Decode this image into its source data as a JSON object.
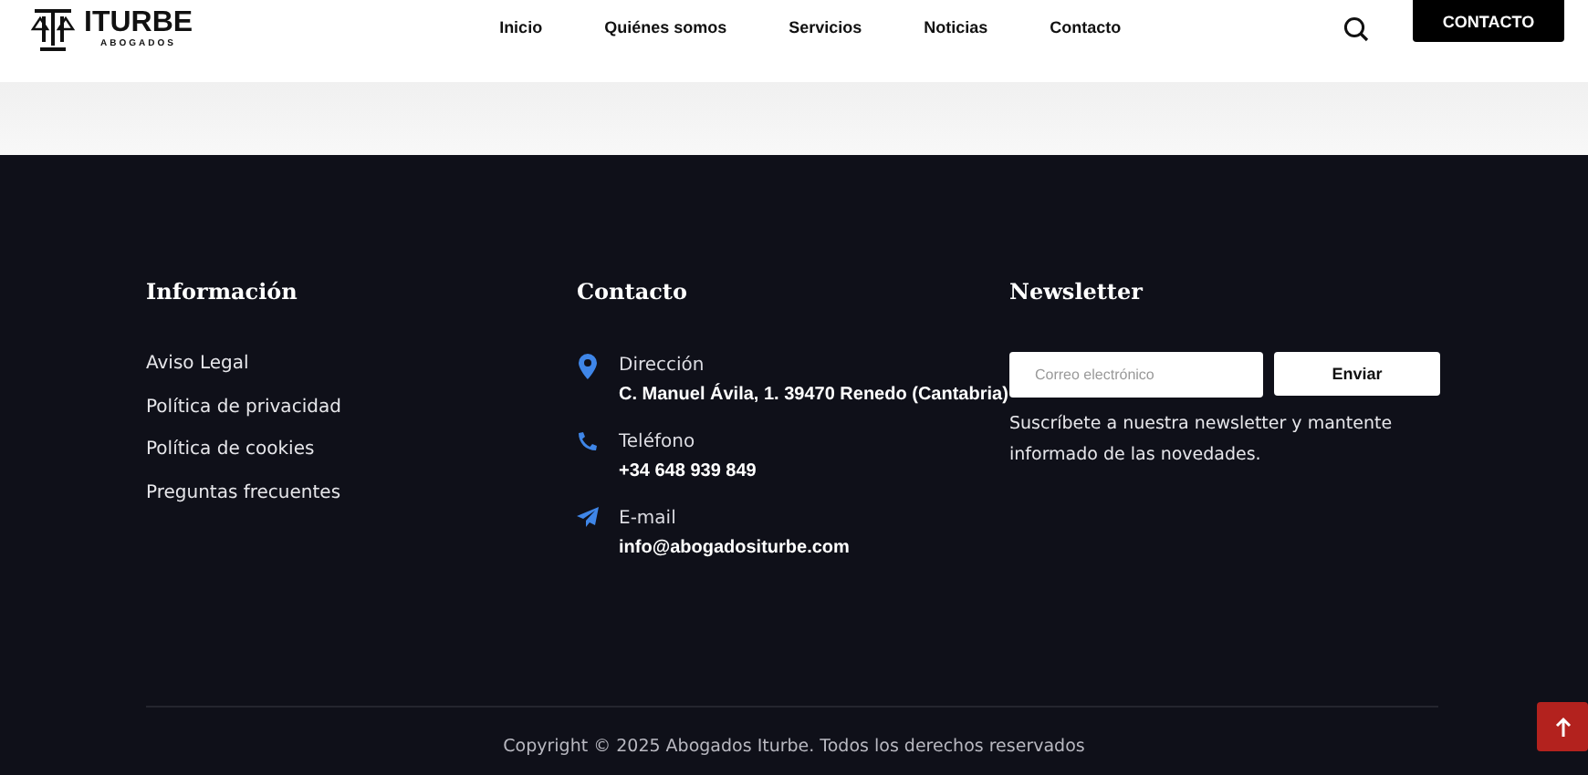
{
  "header": {
    "logo": {
      "name": "ITURBE",
      "tagline": "ABOGADOS"
    },
    "nav": [
      {
        "label": "Inicio"
      },
      {
        "label": "Quiénes somos"
      },
      {
        "label": "Servicios"
      },
      {
        "label": "Noticias"
      },
      {
        "label": "Contacto"
      }
    ],
    "cta": "CONTACTO"
  },
  "footer": {
    "info": {
      "title": "Información",
      "links": [
        "Aviso Legal",
        "Política de privacidad",
        "Política de cookies",
        "Preguntas frecuentes"
      ]
    },
    "contact": {
      "title": "Contacto",
      "items": [
        {
          "kind": "location",
          "label": "Dirección",
          "value": "C. Manuel Ávila, 1. 39470 Renedo (Cantabria)"
        },
        {
          "kind": "phone",
          "label": "Teléfono",
          "value": "+34 648 939 849"
        },
        {
          "kind": "email",
          "label": "E-mail",
          "value": "info@abogadositurbe.com"
        }
      ]
    },
    "newsletter": {
      "title": "Newsletter",
      "placeholder": "Correo electrónico",
      "button": "Enviar",
      "text": "Suscríbete a nuestra newsletter y mantente informado de las novedades."
    },
    "copyright": "Copyright © 2025 Abogados Iturbe. Todos los derechos reservados"
  }
}
